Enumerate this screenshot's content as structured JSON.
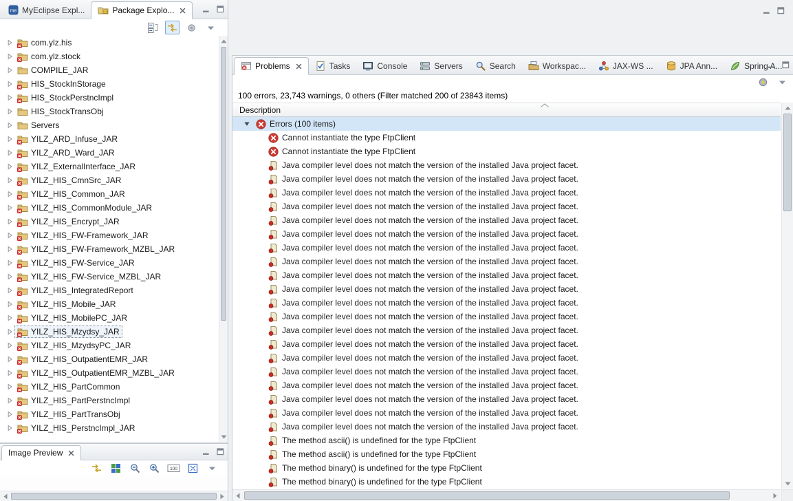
{
  "colors": {
    "error_red": "#cf3a32",
    "selection_blue": "#d2e6f7",
    "toggle_highlight": "#e0edfa"
  },
  "package_explorer": {
    "tabs": [
      {
        "label": "MyEclipse Expl...",
        "icon": "myeclipse-icon",
        "active": false
      },
      {
        "label": "Package Explo...",
        "icon": "package-explorer-icon",
        "active": true,
        "closable": true
      }
    ],
    "toolbar": [
      {
        "name": "collapse-all-icon",
        "toggled": false
      },
      {
        "name": "link-with-editor-icon",
        "toggled": true
      },
      {
        "name": "focus-icon",
        "toggled": false
      },
      {
        "name": "view-menu-icon",
        "toggled": false
      }
    ],
    "items": [
      {
        "label": "com.ylz.his",
        "error": true,
        "selected": false
      },
      {
        "label": "com.ylz.stock",
        "error": true,
        "selected": false
      },
      {
        "label": "COMPILE_JAR",
        "error": false,
        "selected": false
      },
      {
        "label": "HIS_StockInStorage",
        "error": true,
        "selected": false
      },
      {
        "label": "HIS_StockPerstncImpl",
        "error": true,
        "selected": false
      },
      {
        "label": "HIS_StockTransObj",
        "error": false,
        "selected": false
      },
      {
        "label": "Servers",
        "error": false,
        "selected": false
      },
      {
        "label": "YILZ_ARD_Infuse_JAR",
        "error": true,
        "selected": false
      },
      {
        "label": "YILZ_ARD_Ward_JAR",
        "error": true,
        "selected": false
      },
      {
        "label": "YILZ_ExternalInterface_JAR",
        "error": true,
        "selected": false
      },
      {
        "label": "YILZ_HIS_CmnSrc_JAR",
        "error": true,
        "selected": false
      },
      {
        "label": "YILZ_HIS_Common_JAR",
        "error": true,
        "selected": false
      },
      {
        "label": "YILZ_HIS_CommonModule_JAR",
        "error": true,
        "selected": false
      },
      {
        "label": "YILZ_HIS_Encrypt_JAR",
        "error": true,
        "selected": false
      },
      {
        "label": "YILZ_HIS_FW-Framework_JAR",
        "error": true,
        "selected": false
      },
      {
        "label": "YILZ_HIS_FW-Framework_MZBL_JAR",
        "error": true,
        "selected": false
      },
      {
        "label": "YILZ_HIS_FW-Service_JAR",
        "error": true,
        "selected": false
      },
      {
        "label": "YILZ_HIS_FW-Service_MZBL_JAR",
        "error": true,
        "selected": false
      },
      {
        "label": "YILZ_HIS_IntegratedReport",
        "error": true,
        "selected": false
      },
      {
        "label": "YILZ_HIS_Mobile_JAR",
        "error": true,
        "selected": false
      },
      {
        "label": "YILZ_HIS_MobilePC_JAR",
        "error": true,
        "selected": false
      },
      {
        "label": "YILZ_HIS_Mzydsy_JAR",
        "error": true,
        "selected": true
      },
      {
        "label": "YILZ_HIS_MzydsyPC_JAR",
        "error": true,
        "selected": false
      },
      {
        "label": "YILZ_HIS_OutpatientEMR_JAR",
        "error": true,
        "selected": false
      },
      {
        "label": "YILZ_HIS_OutpatientEMR_MZBL_JAR",
        "error": true,
        "selected": false
      },
      {
        "label": "YILZ_HIS_PartCommon",
        "error": true,
        "selected": false
      },
      {
        "label": "YILZ_HIS_PartPerstncImpl",
        "error": true,
        "selected": false
      },
      {
        "label": "YILZ_HIS_PartTransObj",
        "error": true,
        "selected": false
      },
      {
        "label": "YILZ_HIS_PerstncImpl_JAR",
        "error": true,
        "selected": false
      }
    ]
  },
  "image_preview": {
    "tab_label": "Image Preview",
    "toolbar": [
      {
        "name": "link-image-icon",
        "toggled": false
      },
      {
        "name": "grid-icon",
        "toggled": false
      },
      {
        "name": "zoom-out-icon",
        "toggled": false
      },
      {
        "name": "zoom-in-icon",
        "toggled": false
      },
      {
        "name": "actual-size-icon",
        "toggled": false
      },
      {
        "name": "fit-image-icon",
        "toggled": false
      },
      {
        "name": "view-menu-icon",
        "toggled": false
      }
    ]
  },
  "problems": {
    "tabs": [
      {
        "label": "Problems",
        "icon": "problems-icon",
        "active": true,
        "closable": true
      },
      {
        "label": "Tasks",
        "icon": "tasks-icon",
        "active": false
      },
      {
        "label": "Console",
        "icon": "console-icon",
        "active": false
      },
      {
        "label": "Servers",
        "icon": "servers-icon",
        "active": false
      },
      {
        "label": "Search",
        "icon": "search-icon",
        "active": false
      },
      {
        "label": "Workspac...",
        "icon": "workspace-icon",
        "active": false
      },
      {
        "label": "JAX-WS ...",
        "icon": "jaxws-icon",
        "active": false
      },
      {
        "label": "JPA Ann...",
        "icon": "jpa-icon",
        "active": false
      },
      {
        "label": "Spring A...",
        "icon": "spring-icon",
        "active": false
      }
    ],
    "toolbar": [
      {
        "name": "filter-icon",
        "toggled": false
      },
      {
        "name": "view-menu-icon",
        "toggled": false
      }
    ],
    "summary": "100 errors, 23,743 warnings, 0 others (Filter matched 200 of 23843 items)",
    "column_header": "Description",
    "group": {
      "label": "Errors (100 items)",
      "expanded": true,
      "selected": true
    },
    "rows": [
      {
        "icon": "error",
        "text": "Cannot instantiate the type FtpClient"
      },
      {
        "icon": "error",
        "text": "Cannot instantiate the type FtpClient"
      },
      {
        "icon": "marker",
        "text": "Java compiler level does not match the version of the installed Java project facet."
      },
      {
        "icon": "marker",
        "text": "Java compiler level does not match the version of the installed Java project facet."
      },
      {
        "icon": "marker",
        "text": "Java compiler level does not match the version of the installed Java project facet."
      },
      {
        "icon": "marker",
        "text": "Java compiler level does not match the version of the installed Java project facet."
      },
      {
        "icon": "marker",
        "text": "Java compiler level does not match the version of the installed Java project facet."
      },
      {
        "icon": "marker",
        "text": "Java compiler level does not match the version of the installed Java project facet."
      },
      {
        "icon": "marker",
        "text": "Java compiler level does not match the version of the installed Java project facet."
      },
      {
        "icon": "marker",
        "text": "Java compiler level does not match the version of the installed Java project facet."
      },
      {
        "icon": "marker",
        "text": "Java compiler level does not match the version of the installed Java project facet."
      },
      {
        "icon": "marker",
        "text": "Java compiler level does not match the version of the installed Java project facet."
      },
      {
        "icon": "marker",
        "text": "Java compiler level does not match the version of the installed Java project facet."
      },
      {
        "icon": "marker",
        "text": "Java compiler level does not match the version of the installed Java project facet."
      },
      {
        "icon": "marker",
        "text": "Java compiler level does not match the version of the installed Java project facet."
      },
      {
        "icon": "marker",
        "text": "Java compiler level does not match the version of the installed Java project facet."
      },
      {
        "icon": "marker",
        "text": "Java compiler level does not match the version of the installed Java project facet."
      },
      {
        "icon": "marker",
        "text": "Java compiler level does not match the version of the installed Java project facet."
      },
      {
        "icon": "marker",
        "text": "Java compiler level does not match the version of the installed Java project facet."
      },
      {
        "icon": "marker",
        "text": "Java compiler level does not match the version of the installed Java project facet."
      },
      {
        "icon": "marker",
        "text": "Java compiler level does not match the version of the installed Java project facet."
      },
      {
        "icon": "marker",
        "text": "Java compiler level does not match the version of the installed Java project facet."
      },
      {
        "icon": "marker",
        "text": "The method ascii() is undefined for the type FtpClient"
      },
      {
        "icon": "marker",
        "text": "The method ascii() is undefined for the type FtpClient"
      },
      {
        "icon": "marker",
        "text": "The method binary() is undefined for the type FtpClient"
      },
      {
        "icon": "marker",
        "text": "The method binary() is undefined for the type FtpClient"
      }
    ]
  }
}
